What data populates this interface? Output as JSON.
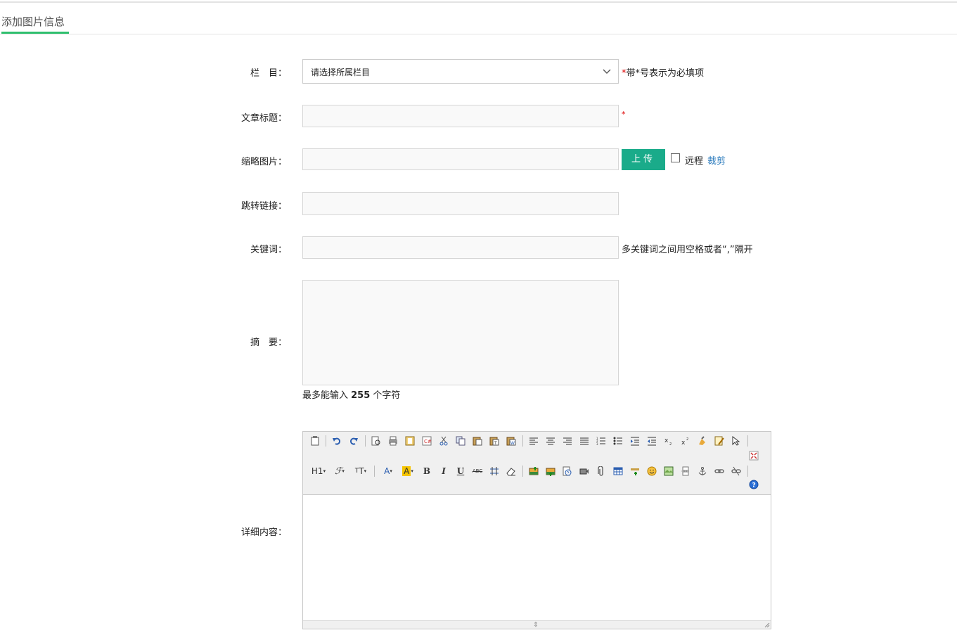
{
  "tab": {
    "title": "添加图片信息"
  },
  "form": {
    "column": {
      "label": "栏　目：",
      "selected": "请选择所属栏目",
      "required_mark": "*",
      "hint": "带*号表示为必填项"
    },
    "title": {
      "label": "文章标题：",
      "required_mark": "*"
    },
    "thumbnail": {
      "label": "缩略图片：",
      "upload_label": "上传",
      "remote_label": "远程",
      "crop_label": "裁剪"
    },
    "link": {
      "label": "跳转链接："
    },
    "keywords": {
      "label": "关键词：",
      "hint": "多关键词之间用空格或者“,”隔开"
    },
    "summary": {
      "label": "摘　要：",
      "note_prefix": "最多能输入 ",
      "note_count": "255",
      "note_suffix": " 个字符"
    },
    "content": {
      "label": "详细内容："
    }
  },
  "colors": {
    "accent": "#2fbf6e",
    "upload_button": "#1aab8a",
    "link": "#2b7bbd",
    "required": "#dd0000"
  },
  "editor": {
    "toolbar_row1": [
      "source-icon",
      "undo-icon",
      "redo-icon",
      "preview-icon",
      "print-icon",
      "template-icon",
      "code-icon",
      "cut-icon",
      "copy-icon",
      "paste-icon",
      "paste-text-icon",
      "paste-word-icon",
      "align-left-icon",
      "align-center-icon",
      "align-right-icon",
      "justify-icon",
      "ordered-list-icon",
      "unordered-list-icon",
      "indent-icon",
      "outdent-icon",
      "subscript-icon",
      "superscript-icon",
      "clear-format-icon",
      "select-all-icon",
      "select-icon",
      "fullscreen-icon"
    ],
    "toolbar_row2": [
      "heading-icon",
      "font-family-icon",
      "font-size-icon",
      "font-color-icon",
      "highlight-icon",
      "bold-icon",
      "italic-icon",
      "underline-icon",
      "strikethrough-icon",
      "line-height-icon",
      "remove-format-icon",
      "image-icon",
      "multi-image-icon",
      "flash-icon",
      "media-icon",
      "attachment-icon",
      "table-icon",
      "hr-icon",
      "emoticon-icon",
      "map-icon",
      "pagebreak-icon",
      "anchor-icon",
      "link-icon",
      "unlink-icon",
      "help-icon"
    ],
    "heading_label": "H1",
    "bold_label": "B",
    "italic_label": "I",
    "underline_label": "U",
    "strike_label": "ABC"
  }
}
